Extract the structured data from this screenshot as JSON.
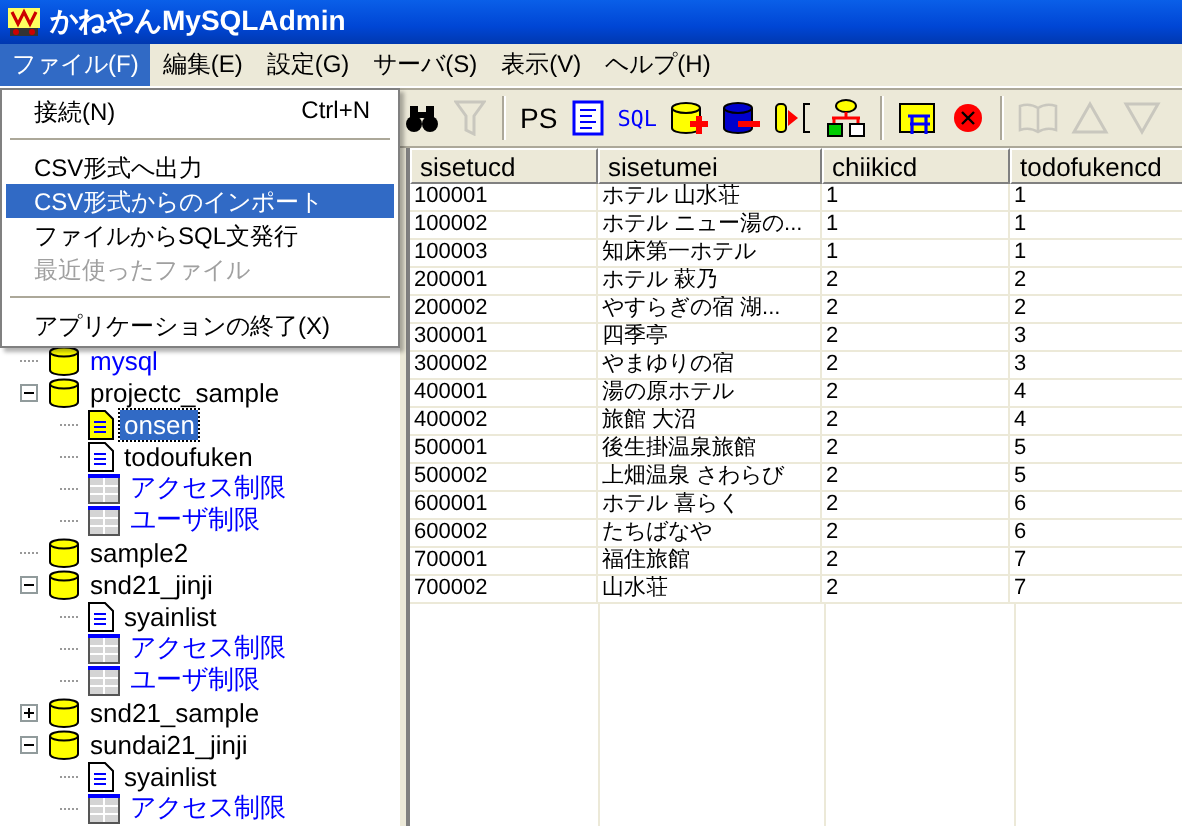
{
  "window": {
    "title": "かねやんMySQLAdmin"
  },
  "menu_bar": [
    {
      "label": "ファイル(F)",
      "selected": true
    },
    {
      "label": "編集(E)",
      "selected": false
    },
    {
      "label": "設定(G)",
      "selected": false
    },
    {
      "label": "サーバ(S)",
      "selected": false
    },
    {
      "label": "表示(V)",
      "selected": false
    },
    {
      "label": "ヘルプ(H)",
      "selected": false
    }
  ],
  "file_menu": [
    {
      "kind": "item",
      "label": "接続(N)",
      "shortcut": "Ctrl+N",
      "selected": false,
      "disabled": false
    },
    {
      "kind": "separator"
    },
    {
      "kind": "item",
      "label": "CSV形式へ出力",
      "selected": false,
      "disabled": false
    },
    {
      "kind": "item",
      "label": "CSV形式からのインポート",
      "selected": true,
      "disabled": false
    },
    {
      "kind": "item",
      "label": "ファイルからSQL文発行",
      "selected": false,
      "disabled": false
    },
    {
      "kind": "item",
      "label": "最近使ったファイル",
      "selected": false,
      "disabled": true
    },
    {
      "kind": "separator"
    },
    {
      "kind": "item",
      "label": "アプリケーションの終了(X)",
      "selected": false,
      "disabled": false
    }
  ],
  "toolbar": [
    {
      "kind": "icon",
      "disabled": false
    },
    {
      "kind": "icon",
      "disabled": true
    },
    {
      "kind": "separator"
    },
    {
      "kind": "text",
      "label": "PS",
      "disabled": false
    },
    {
      "kind": "icon",
      "disabled": false
    },
    {
      "kind": "text",
      "label": "SQL",
      "disabled": false
    },
    {
      "kind": "icon",
      "disabled": false
    },
    {
      "kind": "icon",
      "disabled": false
    },
    {
      "kind": "icon",
      "disabled": false
    },
    {
      "kind": "icon",
      "disabled": false
    },
    {
      "kind": "separator"
    },
    {
      "kind": "icon",
      "disabled": false
    },
    {
      "kind": "icon",
      "disabled": false
    },
    {
      "kind": "separator"
    },
    {
      "kind": "icon",
      "disabled": true
    },
    {
      "kind": "icon",
      "disabled": true
    },
    {
      "kind": "icon",
      "disabled": true
    }
  ],
  "tree": [
    {
      "kind": "system-db",
      "label": "mysql",
      "selected": false
    },
    {
      "kind": "db",
      "label": "projectc_sample",
      "expanded": true,
      "selected": false,
      "children": [
        {
          "kind": "table",
          "label": "onsen",
          "selected": true
        },
        {
          "kind": "table",
          "label": "todoufuken",
          "selected": false
        },
        {
          "kind": "grant",
          "label": "アクセス制限",
          "selected": false
        },
        {
          "kind": "grant",
          "label": "ユーザ制限",
          "selected": false
        }
      ]
    },
    {
      "kind": "db",
      "label": "sample2",
      "selected": false
    },
    {
      "kind": "db",
      "label": "snd21_jinji",
      "expanded": true,
      "selected": false,
      "children": [
        {
          "kind": "table",
          "label": "syainlist",
          "selected": false
        },
        {
          "kind": "grant",
          "label": "アクセス制限",
          "selected": false
        },
        {
          "kind": "grant",
          "label": "ユーザ制限",
          "selected": false
        }
      ]
    },
    {
      "kind": "db",
      "label": "snd21_sample",
      "expanded": false,
      "selected": false
    },
    {
      "kind": "db",
      "label": "sundai21_jinji",
      "expanded": true,
      "selected": false,
      "children": [
        {
          "kind": "table",
          "label": "syainlist",
          "selected": false
        },
        {
          "kind": "grant",
          "label": "アクセス制限",
          "selected": false
        }
      ]
    }
  ],
  "table": {
    "columns": [
      "sisetucd",
      "sisetumei",
      "chiikicd",
      "todofukencd"
    ],
    "rows": [
      [
        "100001",
        "ホテル 山水荘",
        "1",
        "1"
      ],
      [
        "100002",
        "ホテル ニュー湯の...",
        "1",
        "1"
      ],
      [
        "100003",
        "知床第一ホテル",
        "1",
        "1"
      ],
      [
        "200001",
        "ホテル 萩乃",
        "2",
        "2"
      ],
      [
        "200002",
        "やすらぎの宿 湖...",
        "2",
        "2"
      ],
      [
        "300001",
        "四季亭",
        "2",
        "3"
      ],
      [
        "300002",
        "やまゆりの宿",
        "2",
        "3"
      ],
      [
        "400001",
        "湯の原ホテル",
        "2",
        "4"
      ],
      [
        "400002",
        "旅館 大沼",
        "2",
        "4"
      ],
      [
        "500001",
        "後生掛温泉旅館",
        "2",
        "5"
      ],
      [
        "500002",
        "上畑温泉 さわらび",
        "2",
        "5"
      ],
      [
        "600001",
        "ホテル 喜らく",
        "2",
        "6"
      ],
      [
        "600002",
        "たちばなや",
        "2",
        "6"
      ],
      [
        "700001",
        "福住旅館",
        "2",
        "7"
      ],
      [
        "700002",
        "山水荘",
        "2",
        "7"
      ]
    ]
  }
}
